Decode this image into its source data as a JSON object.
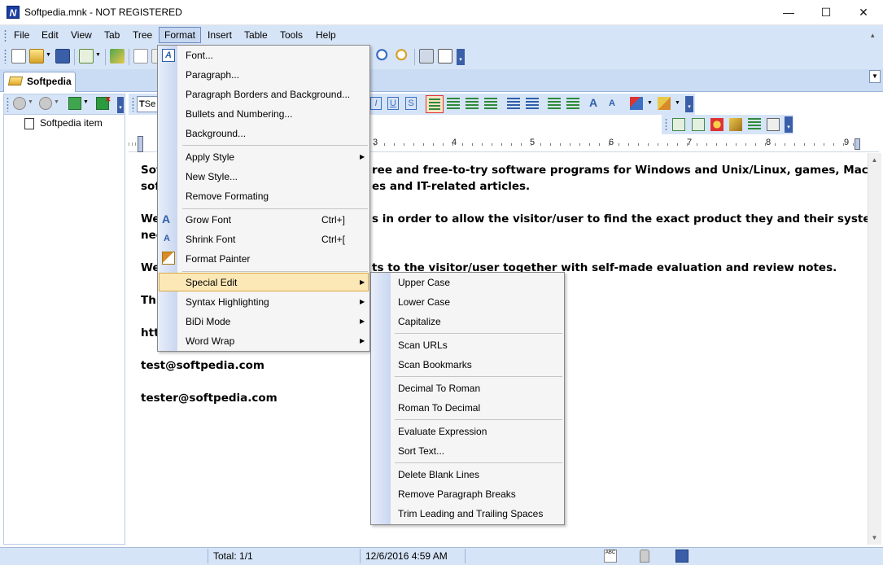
{
  "window": {
    "title": "Softpedia.mnk - NOT REGISTERED",
    "app_icon_letter": "N",
    "minimize": "—",
    "maximize": "☐",
    "close": "✕"
  },
  "menubar": {
    "items": [
      "File",
      "Edit",
      "View",
      "Tab",
      "Tree",
      "Format",
      "Insert",
      "Table",
      "Tools",
      "Help"
    ],
    "active": "Format"
  },
  "tab": {
    "label": "Softpedia"
  },
  "tree": {
    "item": "Softpedia item"
  },
  "edit_toolbar": {
    "style_combo": "Se"
  },
  "ruler": {
    "numbers": [
      "3",
      "4",
      "5",
      "6",
      "7",
      "8",
      "9"
    ]
  },
  "document": {
    "lines": [
      "Sof",
      "sof",
      "We",
      "nee",
      "We",
      "Thi",
      "htt",
      "test@softpedia.com",
      "tester@softpedia.com"
    ],
    "right_fragments": [
      "ree and free-to-try software programs for Windows and Unix/Linux, games, Mac",
      "es and IT-related articles.",
      "s in order to allow the visitor/user to find the exact product they and their system",
      "ts to the visitor/user together with self-made evaluation and review notes."
    ]
  },
  "format_menu": {
    "items": [
      {
        "label": "Font...",
        "shortcut": "",
        "submenu": false
      },
      {
        "label": "Paragraph...",
        "shortcut": "",
        "submenu": false
      },
      {
        "label": "Paragraph Borders and Background...",
        "shortcut": "",
        "submenu": false
      },
      {
        "label": "Bullets and Numbering...",
        "shortcut": "",
        "submenu": false
      },
      {
        "label": "Background...",
        "shortcut": "",
        "submenu": false
      },
      {
        "label": "Apply Style",
        "shortcut": "",
        "submenu": true
      },
      {
        "label": "New Style...",
        "shortcut": "",
        "submenu": false
      },
      {
        "label": "Remove Formating",
        "shortcut": "",
        "submenu": false
      },
      {
        "label": "Grow Font",
        "shortcut": "Ctrl+]",
        "submenu": false
      },
      {
        "label": "Shrink Font",
        "shortcut": "Ctrl+[",
        "submenu": false
      },
      {
        "label": "Format Painter",
        "shortcut": "",
        "submenu": false
      },
      {
        "label": "Special Edit",
        "shortcut": "",
        "submenu": true
      },
      {
        "label": "Syntax Highlighting",
        "shortcut": "",
        "submenu": true
      },
      {
        "label": "BiDi Mode",
        "shortcut": "",
        "submenu": true
      },
      {
        "label": "Word Wrap",
        "shortcut": "",
        "submenu": true
      }
    ],
    "highlighted": "Special Edit",
    "submenu_arrow": "▶"
  },
  "special_edit_menu": {
    "items": [
      "Upper Case",
      "Lower Case",
      "Capitalize",
      "Scan URLs",
      "Scan Bookmarks",
      "Decimal To Roman",
      "Roman To Decimal",
      "Evaluate Expression",
      "Sort Text...",
      "Delete Blank Lines",
      "Remove Paragraph Breaks",
      "Trim Leading and Trailing Spaces"
    ]
  },
  "statusbar": {
    "total": "Total: 1/1",
    "datetime": "12/6/2016 4:59 AM"
  },
  "colors": {
    "toolbar_bg": "#d6e4f7",
    "menu_highlight": "#fce8b7",
    "menu_highlight_border": "#d9a945"
  }
}
